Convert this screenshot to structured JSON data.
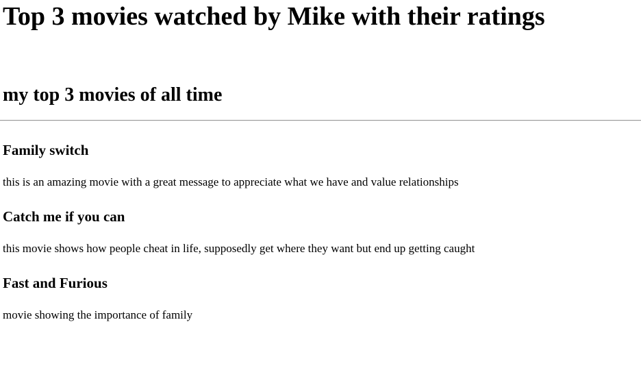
{
  "page": {
    "title": "Top 3 movies watched by Mike with their ratings",
    "subtitle": "my top 3 movies of all time"
  },
  "movies": [
    {
      "name": "Family switch",
      "description": "this is an amazing movie with a great message to appreciate what we have and value relationships"
    },
    {
      "name": "Catch me if you can",
      "description": "this movie shows how people cheat in life, supposedly get where they want but end up getting caught"
    },
    {
      "name": "Fast and Furious",
      "description": "movie showing the importance of family"
    }
  ]
}
